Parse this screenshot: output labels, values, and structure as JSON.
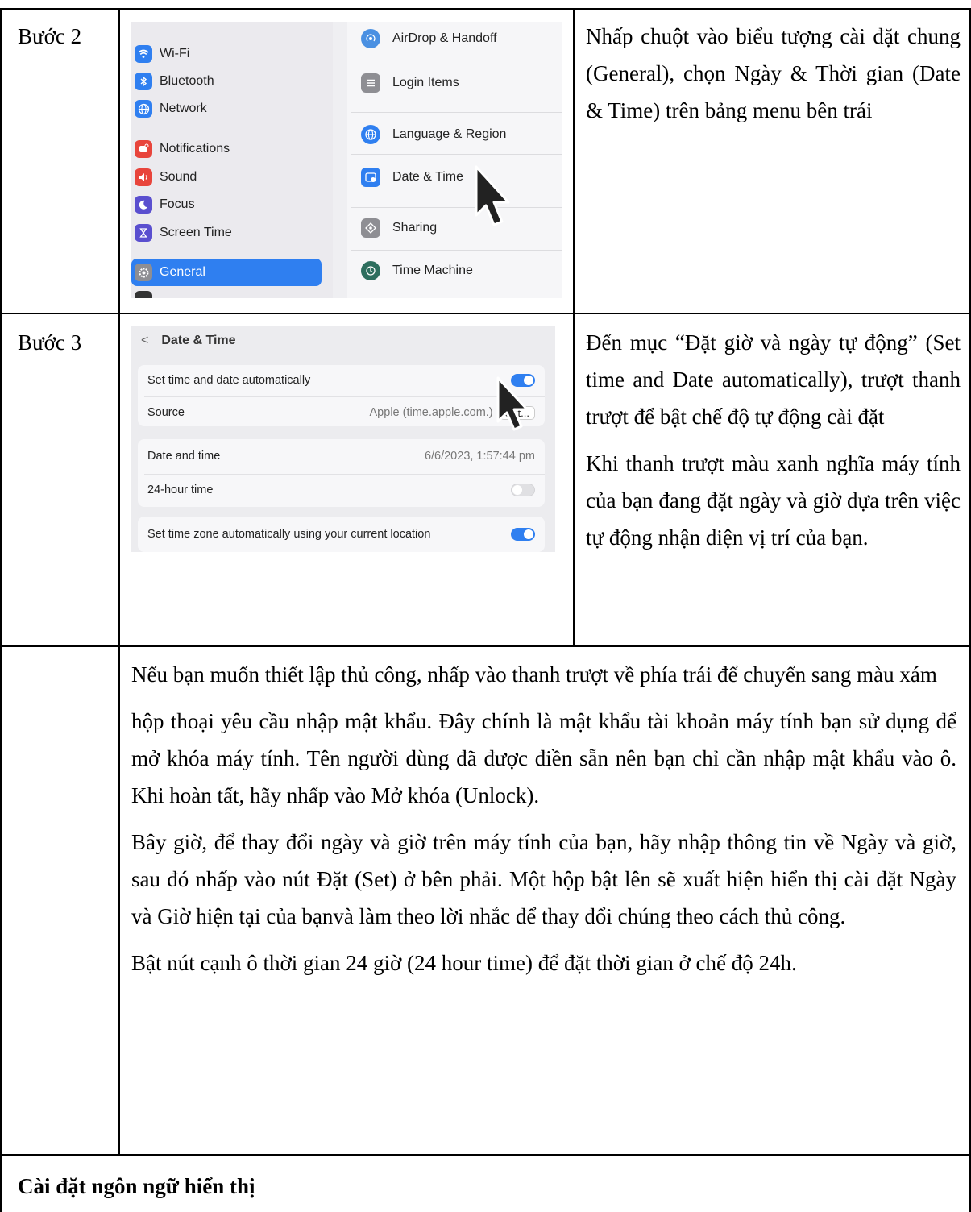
{
  "rows": [
    {
      "label": "Bước 2",
      "description": "Nhấp chuột vào biểu tượng cài đặt chung (General), chọn Ngày & Thời gian (Date & Time) trên bảng menu bên trái"
    },
    {
      "label": "Bước 3",
      "description_1": "Đến mục “Đặt giờ và ngày tự động” (Set time and Date automatically), trượt thanh trượt để bật chế độ tự động cài đặt",
      "description_2": "Khi thanh trượt màu xanh nghĩa máy tính của bạn đang đặt ngày và giờ dựa trên việc tự động nhận diện vị trí của bạn."
    }
  ],
  "screenshot1": {
    "sidebar": [
      {
        "label": "Wi-Fi",
        "icon": "wifi-icon",
        "color": "#2f7ff0"
      },
      {
        "label": "Bluetooth",
        "icon": "bluetooth-icon",
        "color": "#2f7ff0"
      },
      {
        "label": "Network",
        "icon": "globe-icon",
        "color": "#2f7ff0"
      },
      {
        "label": "Notifications",
        "icon": "bell-icon",
        "color": "#e8453c"
      },
      {
        "label": "Sound",
        "icon": "speaker-icon",
        "color": "#e8453c"
      },
      {
        "label": "Focus",
        "icon": "moon-icon",
        "color": "#5a4fcf"
      },
      {
        "label": "Screen Time",
        "icon": "hourglass-icon",
        "color": "#5a4fcf"
      },
      {
        "label": "General",
        "icon": "gear-icon",
        "color": "#8e8e93"
      }
    ],
    "panel": [
      {
        "label": "AirDrop & Handoff",
        "icon": "airdrop-icon",
        "color": "#4a90e2"
      },
      {
        "label": "Login Items",
        "icon": "list-icon",
        "color": "#8e8e93"
      },
      {
        "label": "Language & Region",
        "icon": "globe-icon",
        "color": "#2f7ff0"
      },
      {
        "label": "Date & Time",
        "icon": "calendar-clock-icon",
        "color": "#2f7ff0"
      },
      {
        "label": "Sharing",
        "icon": "sharing-icon",
        "color": "#8e8e93"
      },
      {
        "label": "Time Machine",
        "icon": "time-machine-icon",
        "color": "#2d6e5e"
      }
    ]
  },
  "screenshot2": {
    "back_glyph": "<",
    "title": "Date & Time",
    "set_auto_label": "Set time and date automatically",
    "set_auto_on": true,
    "source_label": "Source",
    "source_value": "Apple (time.apple.com.)",
    "source_button": "Set...",
    "date_time_label": "Date and time",
    "date_time_value": "6/6/2023, 1:57:44 pm",
    "hour24_label": "24-hour time",
    "hour24_on": false,
    "timezone_label": "Set time zone automatically using your current location",
    "timezone_on": true
  },
  "paragraph": {
    "p1": "Nếu bạn muốn thiết lập thủ công, nhấp vào thanh trượt về phía trái để chuyển sang màu xám",
    "p2": "hộp thoại yêu cầu nhập mật khẩu. Đây chính là mật khẩu tài khoản máy tính bạn sử dụng để mở khóa máy tính. Tên người dùng đã được điền sẵn nên bạn chỉ cần nhập mật khẩu vào ô. Khi hoàn tất, hãy nhấp vào Mở khóa (Unlock).",
    "p3": "Bây giờ, để thay đổi ngày và giờ trên máy tính của bạn, hãy nhập thông tin về Ngày và giờ, sau đó nhấp vào nút Đặt (Set) ở bên phải. Một hộp bật lên sẽ xuất hiện hiển thị cài đặt Ngày và Giờ hiện tại của bạnvà làm theo lời nhắc để thay đổi chúng theo cách thủ công.",
    "p4": "Bật nút cạnh ô thời gian 24 giờ (24 hour time) để đặt thời gian ở chế độ 24h."
  },
  "section_title": "Cài đặt ngôn ngữ hiển thị"
}
